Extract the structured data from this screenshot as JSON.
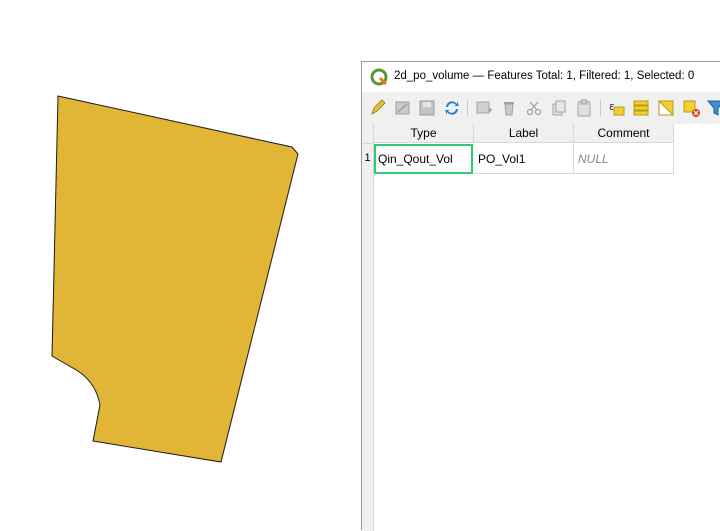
{
  "window": {
    "title": "2d_po_volume — Features Total: 1, Filtered: 1, Selected: 0"
  },
  "toolbar": {
    "buttons": [
      {
        "name": "toggle-editing-icon"
      },
      {
        "name": "multi-edit-icon"
      },
      {
        "name": "save-edits-icon"
      },
      {
        "name": "reload-icon"
      },
      {
        "name": "add-feature-icon"
      },
      {
        "name": "delete-feature-icon"
      },
      {
        "name": "cut-icon"
      },
      {
        "name": "copy-icon"
      },
      {
        "name": "paste-icon"
      },
      {
        "name": "expression-select-icon"
      },
      {
        "name": "select-all-icon"
      },
      {
        "name": "invert-selection-icon"
      },
      {
        "name": "deselect-all-icon"
      },
      {
        "name": "filter-icon"
      }
    ]
  },
  "table": {
    "columns": [
      "Type",
      "Label",
      "Comment"
    ],
    "rows": [
      {
        "num": "1",
        "type": "Qin_Qout_Vol",
        "label": "PO_Vol1",
        "comment": "NULL"
      }
    ]
  },
  "colors": {
    "polygon_fill": "#e1b535",
    "selection_border": "#2ecc71"
  }
}
